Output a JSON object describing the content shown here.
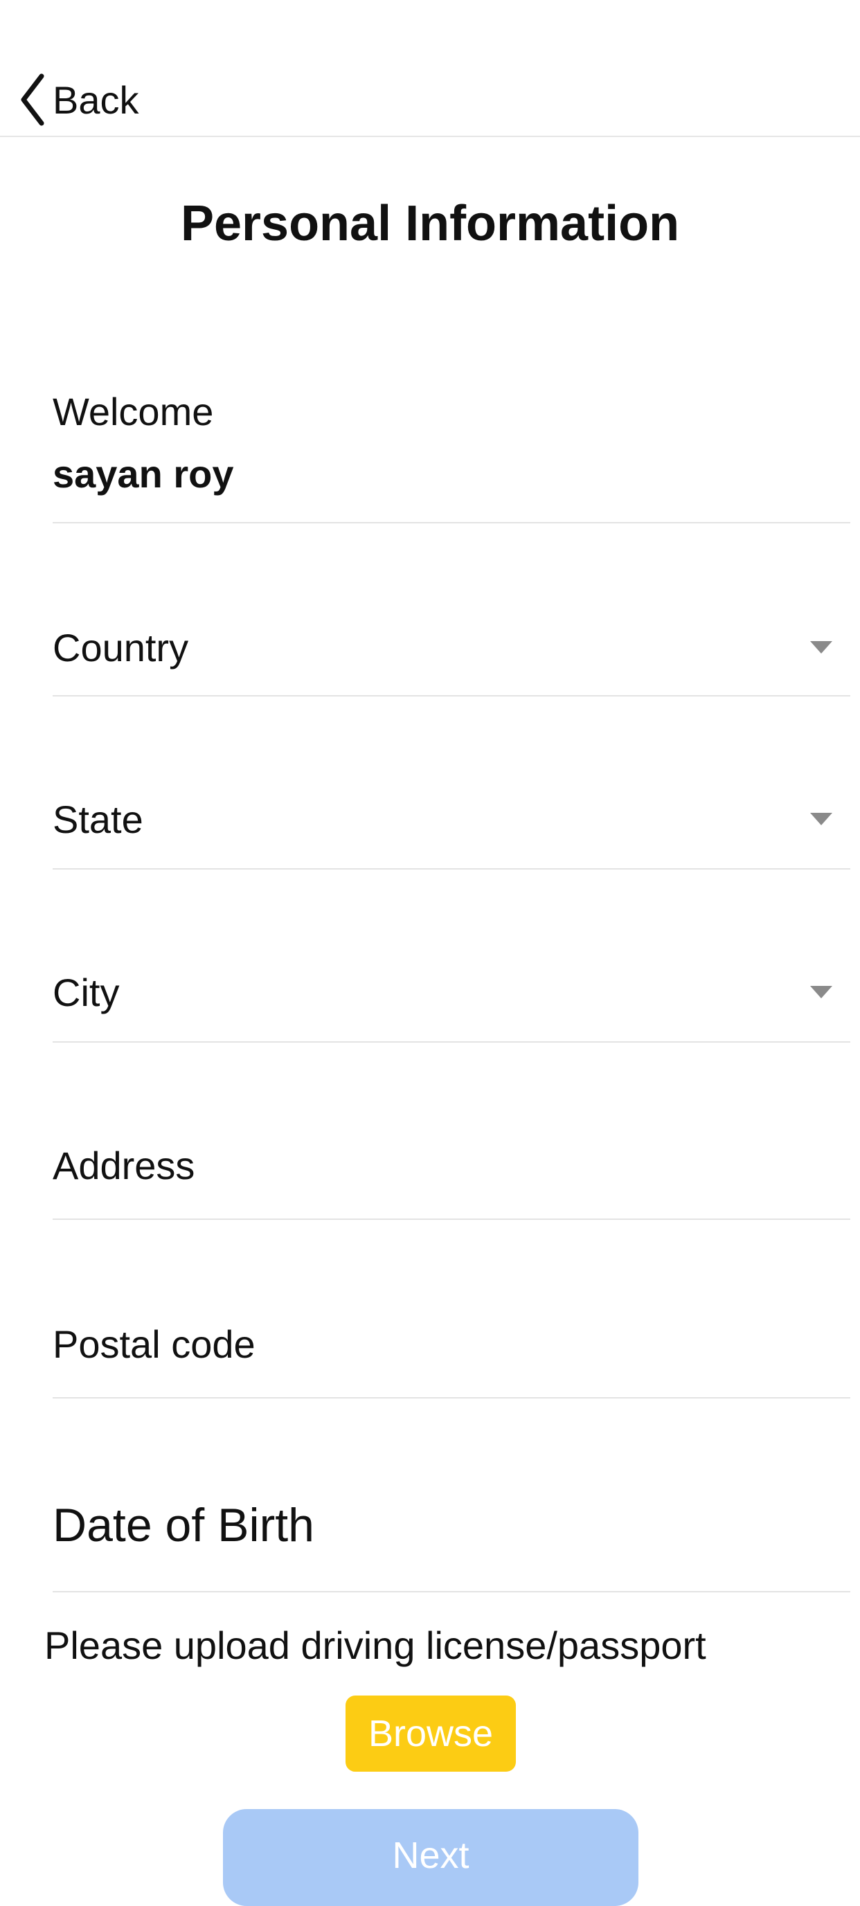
{
  "nav": {
    "back_label": "Back"
  },
  "page": {
    "title": "Personal Information"
  },
  "welcome": {
    "label": "Welcome",
    "name": "sayan roy"
  },
  "form": {
    "country_label": "Country",
    "state_label": "State",
    "city_label": "City",
    "address_placeholder": "Address",
    "postal_code_placeholder": "Postal code",
    "dob_label": "Date of Birth"
  },
  "upload": {
    "prompt": "Please upload driving license/passport",
    "browse_label": "Browse"
  },
  "actions": {
    "next_label": "Next"
  },
  "colors": {
    "browse_button": "#fccc14",
    "next_button_disabled": "#a9c9f6",
    "divider": "#e3e3e3",
    "dropdown_caret": "#8a8a8a"
  }
}
